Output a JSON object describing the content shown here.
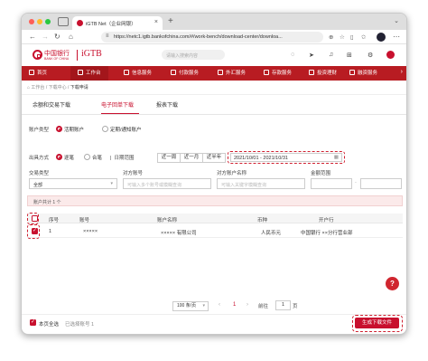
{
  "browser": {
    "tab_title": "iGTB Net（企业网银）",
    "url": "https://netc1.igtb.bankofchina.com/#/work-bench/download-center/downloa..."
  },
  "header": {
    "bank_name": "中国银行",
    "bank_name_en": "BANK OF CHINA",
    "product": "iGTB",
    "search_placeholder": "请输入搜索内容"
  },
  "menu": {
    "items": [
      "首页",
      "工作台",
      "信息服务",
      "付款服务",
      "外汇服务",
      "存款服务",
      "投资理财",
      "融资服务"
    ]
  },
  "breadcrumb": [
    "工作台",
    "下载中心",
    "下载申请"
  ],
  "subtabs": [
    "余额和交易下载",
    "电子回单下载",
    "报表下载"
  ],
  "form": {
    "account_type_label": "账户类型",
    "account_type_options": [
      "活期账户",
      "定期/通知账户"
    ],
    "export_label": "出具方式",
    "export_options": [
      "逐笔",
      "合笔"
    ],
    "date_range_label": "日期范围",
    "date_shortcuts": [
      "近一周",
      "近一月",
      "近半年"
    ],
    "date_value": "2021/10/01 - 2021/10/31",
    "txn_type_label": "交易类型",
    "txn_type_value": "全部",
    "counter_acct_label": "对方账号",
    "counter_acct_placeholder": "可输入多个账号或模糊查询",
    "counter_name_label": "对方账户名称",
    "counter_name_placeholder": "可输入关键字模糊查询",
    "amount_label": "金额范围"
  },
  "table": {
    "summary": "账户共计   1 个",
    "headers": [
      "序号",
      "账号",
      "账户名称",
      "币种",
      "开户行"
    ],
    "rows": [
      {
        "no": "1",
        "account": "×××××",
        "name": "×××××  有限公司",
        "currency": "人民币元",
        "branch": "中国银行 ××分行营业部"
      }
    ]
  },
  "pagination": {
    "page_size": "100 条/页",
    "current": "1",
    "goto_label": "前往",
    "goto_value": "1",
    "page_label": "页"
  },
  "footer": {
    "select_all": "本页全选",
    "selected": "已选择账号 1",
    "generate": "生成下载文件"
  },
  "colors": {
    "brand": "#c8102e",
    "menu_bg": "#b81c22"
  }
}
